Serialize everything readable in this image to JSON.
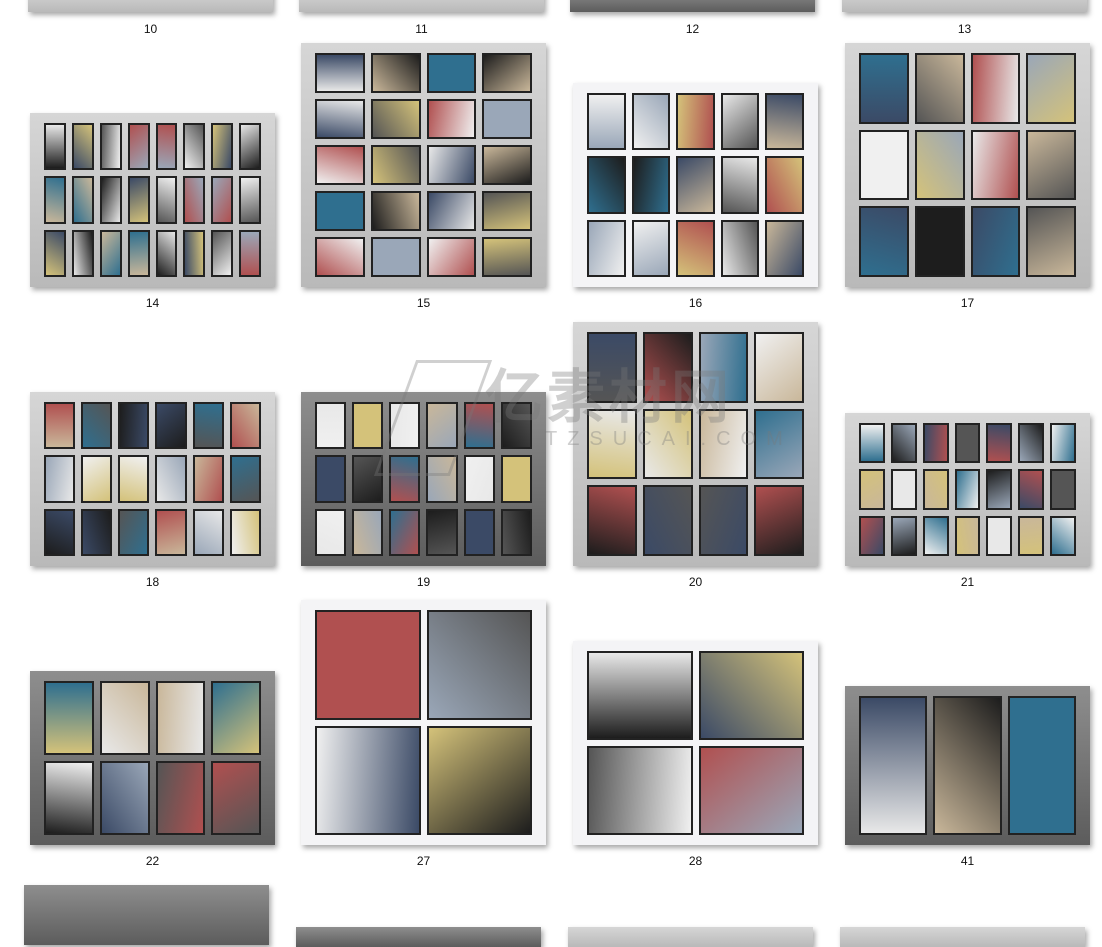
{
  "gallery": {
    "items": [
      {
        "label": "10"
      },
      {
        "label": "11"
      },
      {
        "label": "12"
      },
      {
        "label": "13"
      },
      {
        "label": "14"
      },
      {
        "label": "15"
      },
      {
        "label": "16"
      },
      {
        "label": "17"
      },
      {
        "label": "18"
      },
      {
        "label": "19"
      },
      {
        "label": "20"
      },
      {
        "label": "21"
      },
      {
        "label": "22"
      },
      {
        "label": "27"
      },
      {
        "label": "28"
      },
      {
        "label": "41"
      }
    ]
  },
  "watermark": {
    "cn": "亿素材网",
    "en": "TZSUCAI.COM"
  }
}
